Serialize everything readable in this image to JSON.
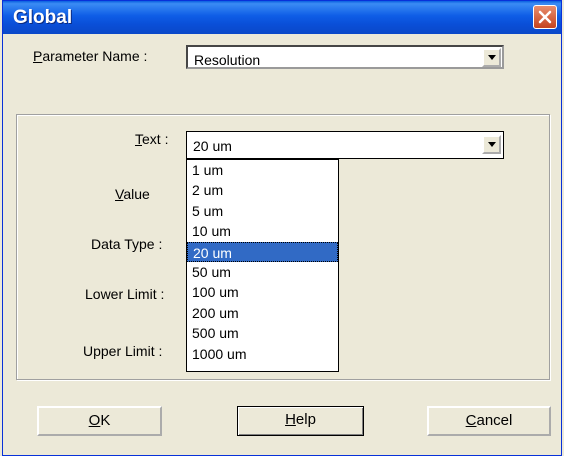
{
  "window": {
    "title": "Global"
  },
  "param": {
    "label_acc": "P",
    "label_rest": "arameter Name :",
    "value": "Resolution"
  },
  "text_field": {
    "label_acc": "T",
    "label_rest": "ext :",
    "value": "20 um"
  },
  "labels": {
    "value_acc": "V",
    "value_rest": "alue",
    "data_type": "Data Type :",
    "lower_limit": "Lower Limit :",
    "upper_limit": "Upper Limit :"
  },
  "dropdown": {
    "options": [
      "1 um",
      "2 um",
      "5 um",
      "10 um",
      "20 um",
      "50 um",
      "100 um",
      "200 um",
      "500 um",
      "1000 um"
    ],
    "selected": "20 um"
  },
  "buttons": {
    "ok_acc": "O",
    "ok_rest": "K",
    "help_acc": "H",
    "help_rest": "elp",
    "cancel_acc": "C",
    "cancel_rest": "ancel"
  },
  "colors": {
    "selection": "#316ac5",
    "titlebar": "#0a4fd8",
    "close": "#c5421e"
  }
}
